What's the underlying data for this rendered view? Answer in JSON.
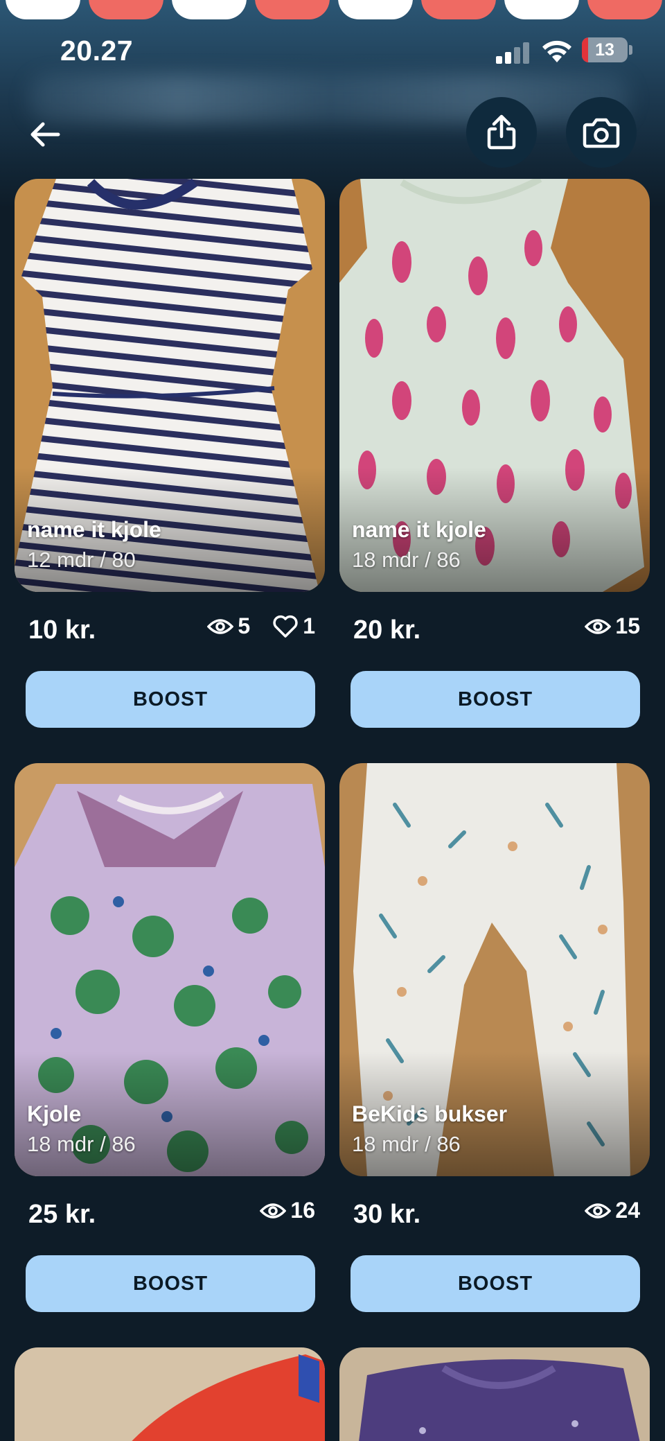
{
  "status_bar": {
    "time": "20.27",
    "battery_level": "13",
    "battery_fraction": 0.13
  },
  "header": {
    "back_icon": "arrow-left-icon",
    "share_icon": "share-icon",
    "camera_icon": "camera-icon"
  },
  "colors": {
    "background": "#0e1c28",
    "boost_button": "#a9d4f9",
    "boost_text": "#0b1a26",
    "header_button": "#0f2a3d",
    "tab_dot_coral": "#ef6a63"
  },
  "listings": [
    {
      "title": "name it kjole",
      "size": "12 mdr / 80",
      "price": "10 kr.",
      "views": "5",
      "likes": "1",
      "boost_label": "BOOST"
    },
    {
      "title": "name it kjole",
      "size": "18 mdr / 86",
      "price": "20 kr.",
      "views": "15",
      "boost_label": "BOOST"
    },
    {
      "title": "Kjole",
      "size": "18 mdr / 86",
      "price": "25 kr.",
      "views": "16",
      "boost_label": "BOOST"
    },
    {
      "title": "BeKids bukser",
      "size": "18 mdr / 86",
      "price": "30 kr.",
      "views": "24",
      "boost_label": "BOOST"
    }
  ]
}
